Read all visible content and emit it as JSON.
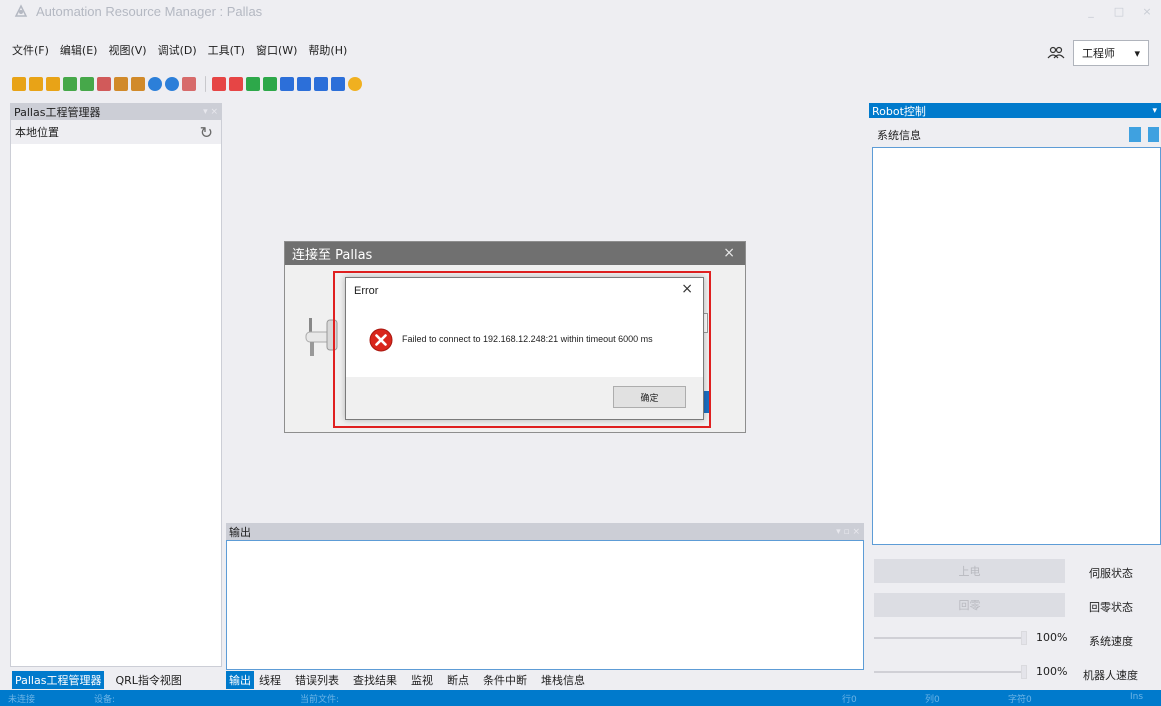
{
  "window": {
    "title": "Automation Resource Manager : Pallas",
    "controls": [
      "_",
      "□",
      "×"
    ]
  },
  "menu": [
    "文件(F)",
    "编辑(E)",
    "视图(V)",
    "调试(D)",
    "工具(T)",
    "窗口(W)",
    "帮助(H)"
  ],
  "role": {
    "value": "工程师",
    "arrow": "▾"
  },
  "left_panel": {
    "title": "Pallas工程管理器",
    "subheader": "本地位置",
    "close": "▾ ×",
    "refresh": "↻"
  },
  "right_panel": {
    "title": "Robot控制",
    "pin": "▾",
    "subheader": "系统信息",
    "buttons": [
      {
        "label": "上电",
        "status": "伺服状态"
      },
      {
        "label": "回零",
        "status": "回零状态"
      }
    ],
    "sliders": [
      {
        "value": "100%",
        "label": "系统速度"
      },
      {
        "value": "100%",
        "label": "机器人速度"
      }
    ]
  },
  "output": {
    "title": "输出",
    "close": "▾ ▫ ×"
  },
  "bottom_tabs_left": [
    {
      "label": "Pallas工程管理器",
      "active": true
    },
    {
      "label": "QRL指令视图",
      "active": false
    }
  ],
  "bottom_tabs_main": [
    {
      "label": "输出",
      "active": true
    },
    {
      "label": "线程",
      "active": false
    },
    {
      "label": "错误列表",
      "active": false
    },
    {
      "label": "查找结果",
      "active": false
    },
    {
      "label": "监视",
      "active": false
    },
    {
      "label": "断点",
      "active": false
    },
    {
      "label": "条件中断",
      "active": false
    },
    {
      "label": "堆栈信息",
      "active": false
    }
  ],
  "statusbar": {
    "connection": "未连接",
    "device": "设备:",
    "current_file": "当前文件:",
    "row": "行0",
    "col": "列0",
    "char": "字符0",
    "mode": "Ins"
  },
  "connect_dialog": {
    "title": "连接至 Pallas",
    "close": "×"
  },
  "error_dialog": {
    "title": "Error",
    "close": "×",
    "message": "Failed to connect to 192.168.12.248:21 within timeout 6000 ms",
    "ok_label": "确定"
  },
  "colors": {
    "accent": "#007acc",
    "highlight": "#e02020",
    "error": "#d9261c"
  }
}
